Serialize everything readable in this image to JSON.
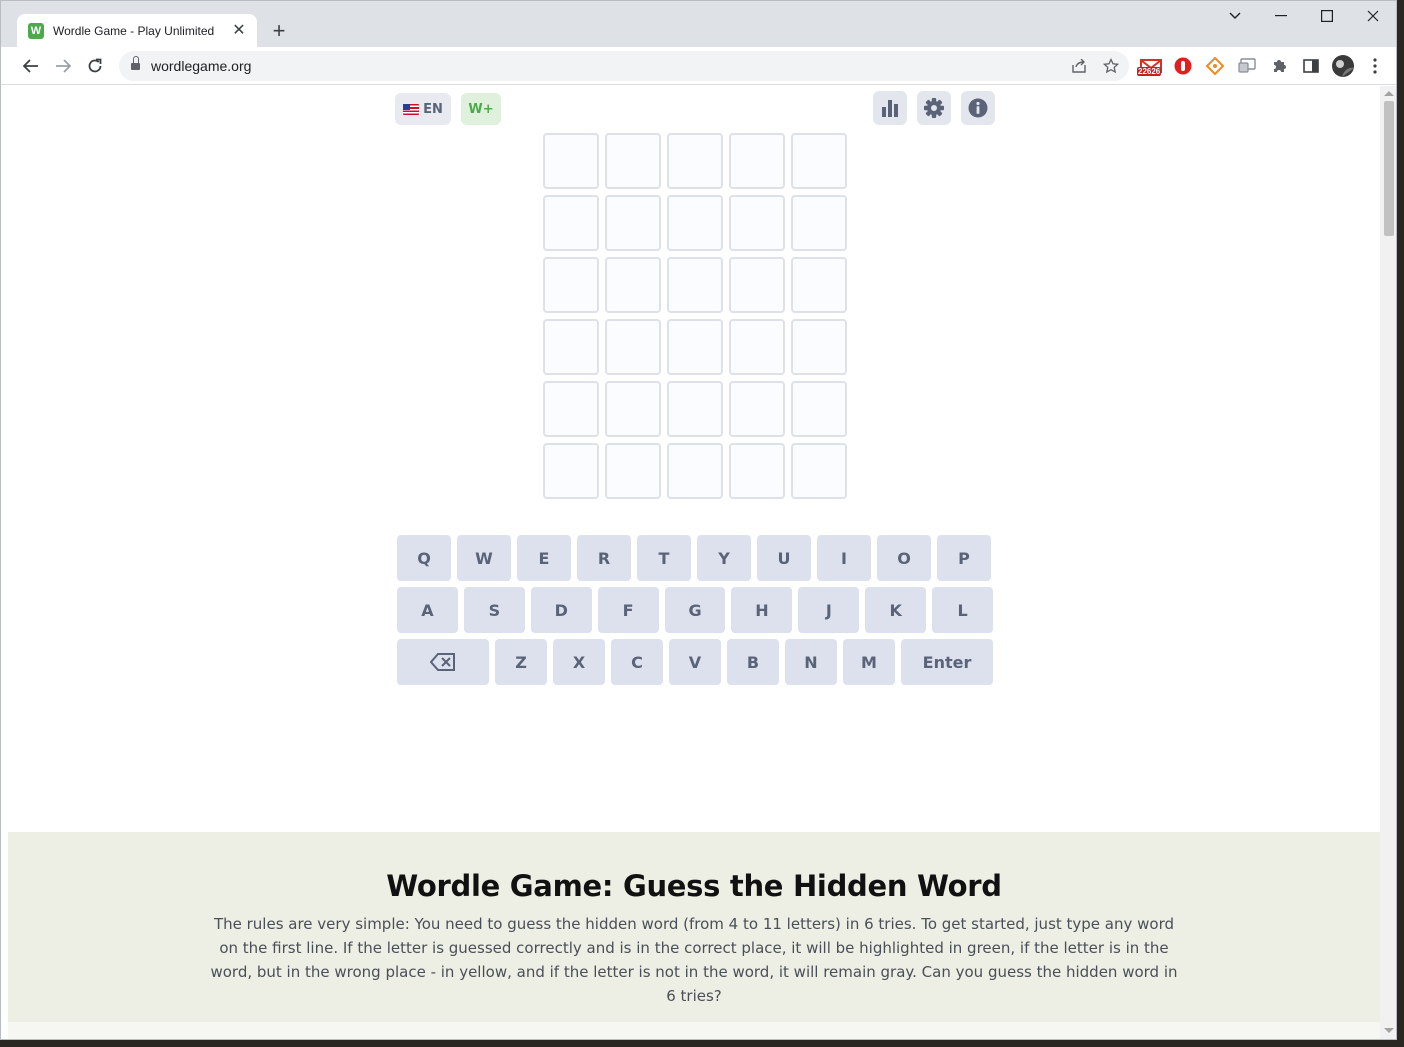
{
  "browser": {
    "tab": {
      "favicon_letter": "W",
      "title": "Wordle Game - Play Unlimited",
      "close_glyph": "✕"
    },
    "new_tab_glyph": "+",
    "url": "wordlegame.org",
    "gmail_badge": "22626",
    "window_controls": {
      "dropdown": "⌄",
      "minimize": "—",
      "maximize": "☐",
      "close": "✕"
    }
  },
  "header": {
    "language": "EN",
    "wplus": "W+"
  },
  "board": {
    "rows": 6,
    "cols": 5
  },
  "keyboard": {
    "row1": [
      "Q",
      "W",
      "E",
      "R",
      "T",
      "Y",
      "U",
      "I",
      "O",
      "P"
    ],
    "row2": [
      "A",
      "S",
      "D",
      "F",
      "G",
      "H",
      "J",
      "K",
      "L"
    ],
    "row3": [
      "Z",
      "X",
      "C",
      "V",
      "B",
      "N",
      "M"
    ],
    "enter": "Enter"
  },
  "info": {
    "title": "Wordle Game: Guess the Hidden Word",
    "text": "The rules are very simple: You need to guess the hidden word (from 4 to 11 letters) in 6 tries. To get started, just type any word on the first line. If the letter is guessed correctly and is in the correct place, it will be highlighted in green, if the letter is in the word, but in the wrong place - in yellow, and if the letter is not in the word, it will remain gray. Can you guess the hidden word in 6 tries?"
  },
  "colors": {
    "accent_green": "#4caa4a",
    "key_bg": "#dce1ed",
    "info_bg": "#edefe4"
  }
}
